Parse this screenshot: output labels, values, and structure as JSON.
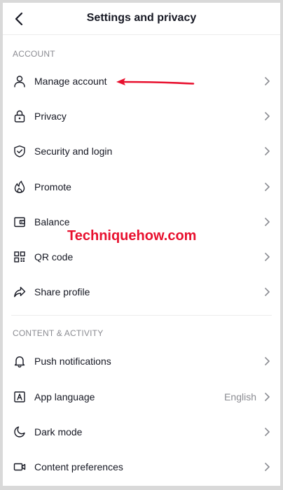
{
  "header": {
    "title": "Settings and privacy"
  },
  "sections": {
    "account": {
      "label": "ACCOUNT",
      "items": [
        {
          "label": "Manage account",
          "icon": "person-icon"
        },
        {
          "label": "Privacy",
          "icon": "lock-icon"
        },
        {
          "label": "Security and login",
          "icon": "shield-icon"
        },
        {
          "label": "Promote",
          "icon": "flame-icon"
        },
        {
          "label": "Balance",
          "icon": "wallet-icon"
        },
        {
          "label": "QR code",
          "icon": "qr-code-icon"
        },
        {
          "label": "Share profile",
          "icon": "share-icon"
        }
      ]
    },
    "content": {
      "label": "CONTENT & ACTIVITY",
      "items": [
        {
          "label": "Push notifications",
          "icon": "bell-icon"
        },
        {
          "label": "App language",
          "icon": "language-icon",
          "value": "English"
        },
        {
          "label": "Dark mode",
          "icon": "moon-icon"
        },
        {
          "label": "Content preferences",
          "icon": "video-camera-icon"
        }
      ]
    }
  },
  "annotation": {
    "watermark": "Techniquehow.com",
    "arrow_color": "#e8102e"
  },
  "colors": {
    "text": "#161823",
    "muted": "#8a8b91",
    "accent": "#e8102e"
  }
}
